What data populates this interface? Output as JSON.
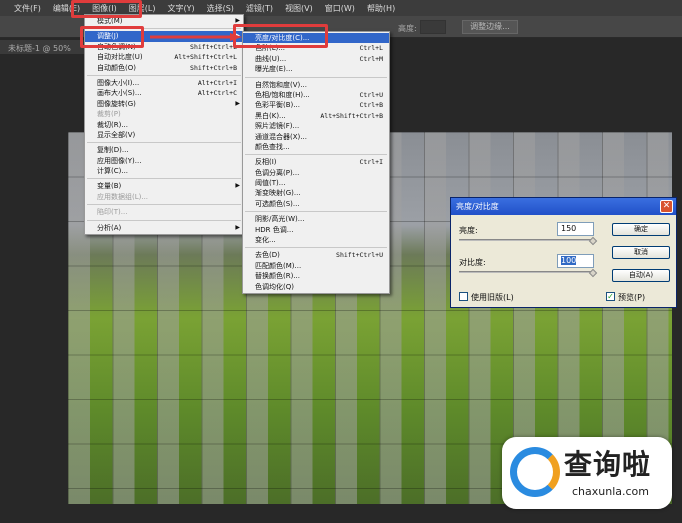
{
  "menubar": [
    "文件(F)",
    "编辑(E)",
    "图像(I)",
    "图层(L)",
    "文字(Y)",
    "选择(S)",
    "滤镜(T)",
    "视图(V)",
    "窗口(W)",
    "帮助(H)"
  ],
  "options": {
    "label": "高度:",
    "button": "调整边缘..."
  },
  "doc_tab": "未标题-1 @ 50%",
  "image_menu": [
    {
      "label": "模式(M)",
      "arrow": true
    },
    {
      "sep": true
    },
    {
      "label": "调整(J)",
      "arrow": true,
      "selected": true
    },
    {
      "label": "自动色调(N)",
      "shortcut": "Shift+Ctrl+L"
    },
    {
      "label": "自动对比度(U)",
      "shortcut": "Alt+Shift+Ctrl+L"
    },
    {
      "label": "自动颜色(O)",
      "shortcut": "Shift+Ctrl+B"
    },
    {
      "sep": true
    },
    {
      "label": "图像大小(I)...",
      "shortcut": "Alt+Ctrl+I"
    },
    {
      "label": "画布大小(S)...",
      "shortcut": "Alt+Ctrl+C"
    },
    {
      "label": "图像旋转(G)",
      "arrow": true
    },
    {
      "label": "裁剪(P)",
      "disabled": true
    },
    {
      "label": "裁切(R)..."
    },
    {
      "label": "显示全部(V)"
    },
    {
      "sep": true
    },
    {
      "label": "复制(D)..."
    },
    {
      "label": "应用图像(Y)..."
    },
    {
      "label": "计算(C)..."
    },
    {
      "sep": true
    },
    {
      "label": "变量(B)",
      "arrow": true
    },
    {
      "label": "应用数据组(L)...",
      "disabled": true
    },
    {
      "sep": true
    },
    {
      "label": "陷印(T)...",
      "disabled": true
    },
    {
      "sep": true
    },
    {
      "label": "分析(A)",
      "arrow": true
    }
  ],
  "adjust_menu": [
    {
      "label": "亮度/对比度(C)...",
      "selected": true
    },
    {
      "label": "色阶(L)...",
      "shortcut": "Ctrl+L"
    },
    {
      "label": "曲线(U)...",
      "shortcut": "Ctrl+M"
    },
    {
      "label": "曝光度(E)..."
    },
    {
      "sep": true
    },
    {
      "label": "自然饱和度(V)..."
    },
    {
      "label": "色相/饱和度(H)...",
      "shortcut": "Ctrl+U"
    },
    {
      "label": "色彩平衡(B)...",
      "shortcut": "Ctrl+B"
    },
    {
      "label": "黑白(K)...",
      "shortcut": "Alt+Shift+Ctrl+B"
    },
    {
      "label": "照片滤镜(F)..."
    },
    {
      "label": "通道混合器(X)..."
    },
    {
      "label": "颜色查找..."
    },
    {
      "sep": true
    },
    {
      "label": "反相(I)",
      "shortcut": "Ctrl+I"
    },
    {
      "label": "色调分离(P)..."
    },
    {
      "label": "阈值(T)..."
    },
    {
      "label": "渐变映射(G)..."
    },
    {
      "label": "可选颜色(S)..."
    },
    {
      "sep": true
    },
    {
      "label": "阴影/高光(W)..."
    },
    {
      "label": "HDR 色调..."
    },
    {
      "label": "变化..."
    },
    {
      "sep": true
    },
    {
      "label": "去色(D)",
      "shortcut": "Shift+Ctrl+U"
    },
    {
      "label": "匹配颜色(M)..."
    },
    {
      "label": "替换颜色(R)..."
    },
    {
      "label": "色调均化(Q)"
    }
  ],
  "dialog": {
    "title": "亮度/对比度",
    "brightness_label": "亮度:",
    "brightness": "150",
    "brightness_level": 1.0,
    "contrast_label": "对比度:",
    "contrast": "100",
    "contrast_level": 1.0,
    "ok": "确定",
    "cancel": "取消",
    "auto": "自动(A)",
    "legacy": "使用旧版(L)",
    "legacy_checked": false,
    "preview": "预览(P)",
    "preview_checked": true
  },
  "watermark": {
    "text": "查询啦",
    "url": "chaxunla.com"
  },
  "colors": {
    "highlight": "#e03c3c",
    "selection": "#3166c9"
  }
}
